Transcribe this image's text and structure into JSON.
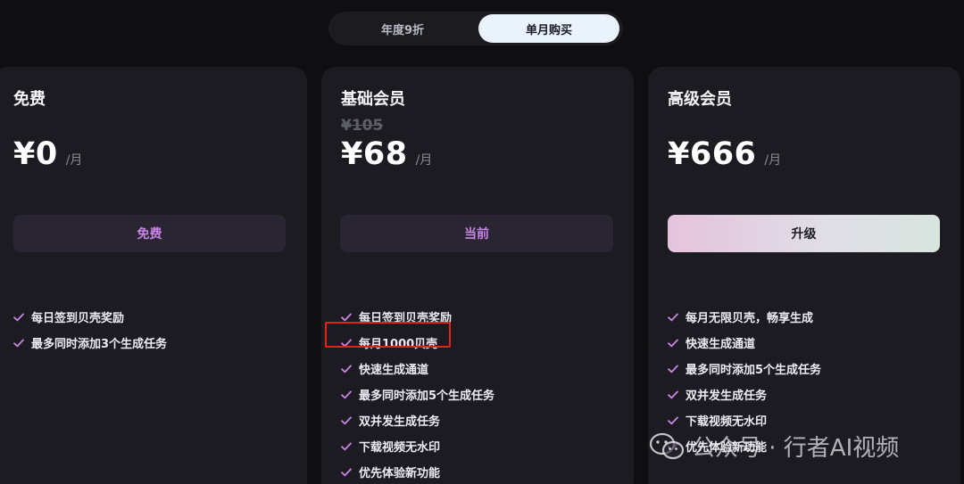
{
  "billing_toggle": {
    "yearly_label": "年度9折",
    "monthly_label": "单月购买",
    "selected": "monthly"
  },
  "plans": [
    {
      "name": "免费",
      "price": "¥0",
      "period": "/月",
      "button_label": "免费",
      "features": [
        "每日签到贝壳奖励",
        "最多同时添加3个生成任务"
      ]
    },
    {
      "name": "基础会员",
      "original_price": "¥105",
      "price": "¥68",
      "period": "/月",
      "button_label": "当前",
      "features": [
        "每日签到贝壳奖励",
        "每月1000贝壳",
        "快速生成通道",
        "最多同时添加5个生成任务",
        "双并发生成任务",
        "下载视频无水印",
        "优先体验新功能"
      ]
    },
    {
      "name": "高级会员",
      "price": "¥666",
      "period": "/月",
      "button_label": "升级",
      "features": [
        "每月无限贝壳，畅享生成",
        "快速生成通道",
        "最多同时添加5个生成任务",
        "双并发生成任务",
        "下载视频无水印",
        "优先体验新功能"
      ]
    }
  ],
  "watermark": {
    "text": "公众号 · 行者AI视频",
    "icon": "wechat-icon"
  },
  "colors": {
    "background": "#0f0f12",
    "card": "#1c1b22",
    "accent_purple": "#c985e6",
    "check_color": "#c985e6",
    "annotation_red": "#e2231a"
  }
}
